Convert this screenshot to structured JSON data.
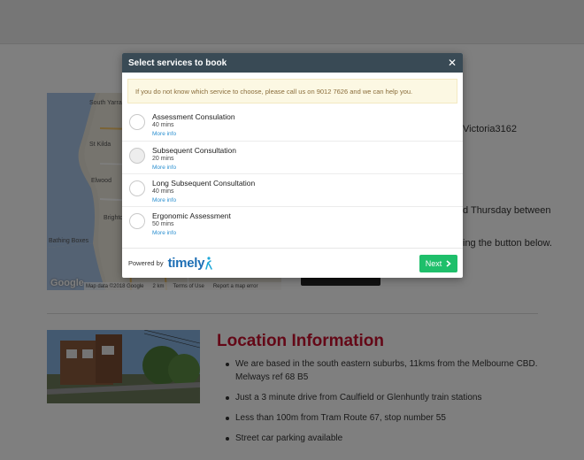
{
  "background": {
    "address_fragment": "Victoria3162",
    "hours_fragment": "d Thursday between",
    "button_fragment": "ing the button below.",
    "map": {
      "labels": [
        "South Yarra",
        "St Kilda",
        "Elwood",
        "Brighton",
        "Bathing Boxes"
      ],
      "google": "Google",
      "footer": [
        "Map data ©2018 Google",
        "2 km",
        "Terms of Use",
        "Report a map error"
      ]
    },
    "location": {
      "title": "Location Information",
      "items": [
        "We are based in the south eastern suburbs, 11kms from the Melbourne CBD. Melways ref 68 B5",
        "Just a 3 minute drive from Caulfield or Glenhuntly train stations",
        "Less than 100m from Tram Route 67, stop number 55",
        "Street car parking available"
      ]
    }
  },
  "modal": {
    "title": "Select services to book",
    "close_icon": "close-icon",
    "notice": "If you do not know which service to choose, please call us on 9012 7626 and we can help you.",
    "services": [
      {
        "name": "Assessment Consulation",
        "duration": "40 mins",
        "more": "More info"
      },
      {
        "name": "Subsequent Consultation",
        "duration": "20 mins",
        "more": "More info"
      },
      {
        "name": "Long Subsequent Consultation",
        "duration": "40 mins",
        "more": "More info"
      },
      {
        "name": "Ergonomic Assessment",
        "duration": "50 mins",
        "more": "More info"
      }
    ],
    "footer": {
      "powered_by": "Powered by",
      "brand": "timely",
      "next_label": "Next"
    }
  },
  "colors": {
    "header": "#394a55",
    "next_button": "#1fbf6b",
    "link": "#2a8fd0",
    "location_title": "#c8102e",
    "notice_bg": "#fcf8e3"
  }
}
